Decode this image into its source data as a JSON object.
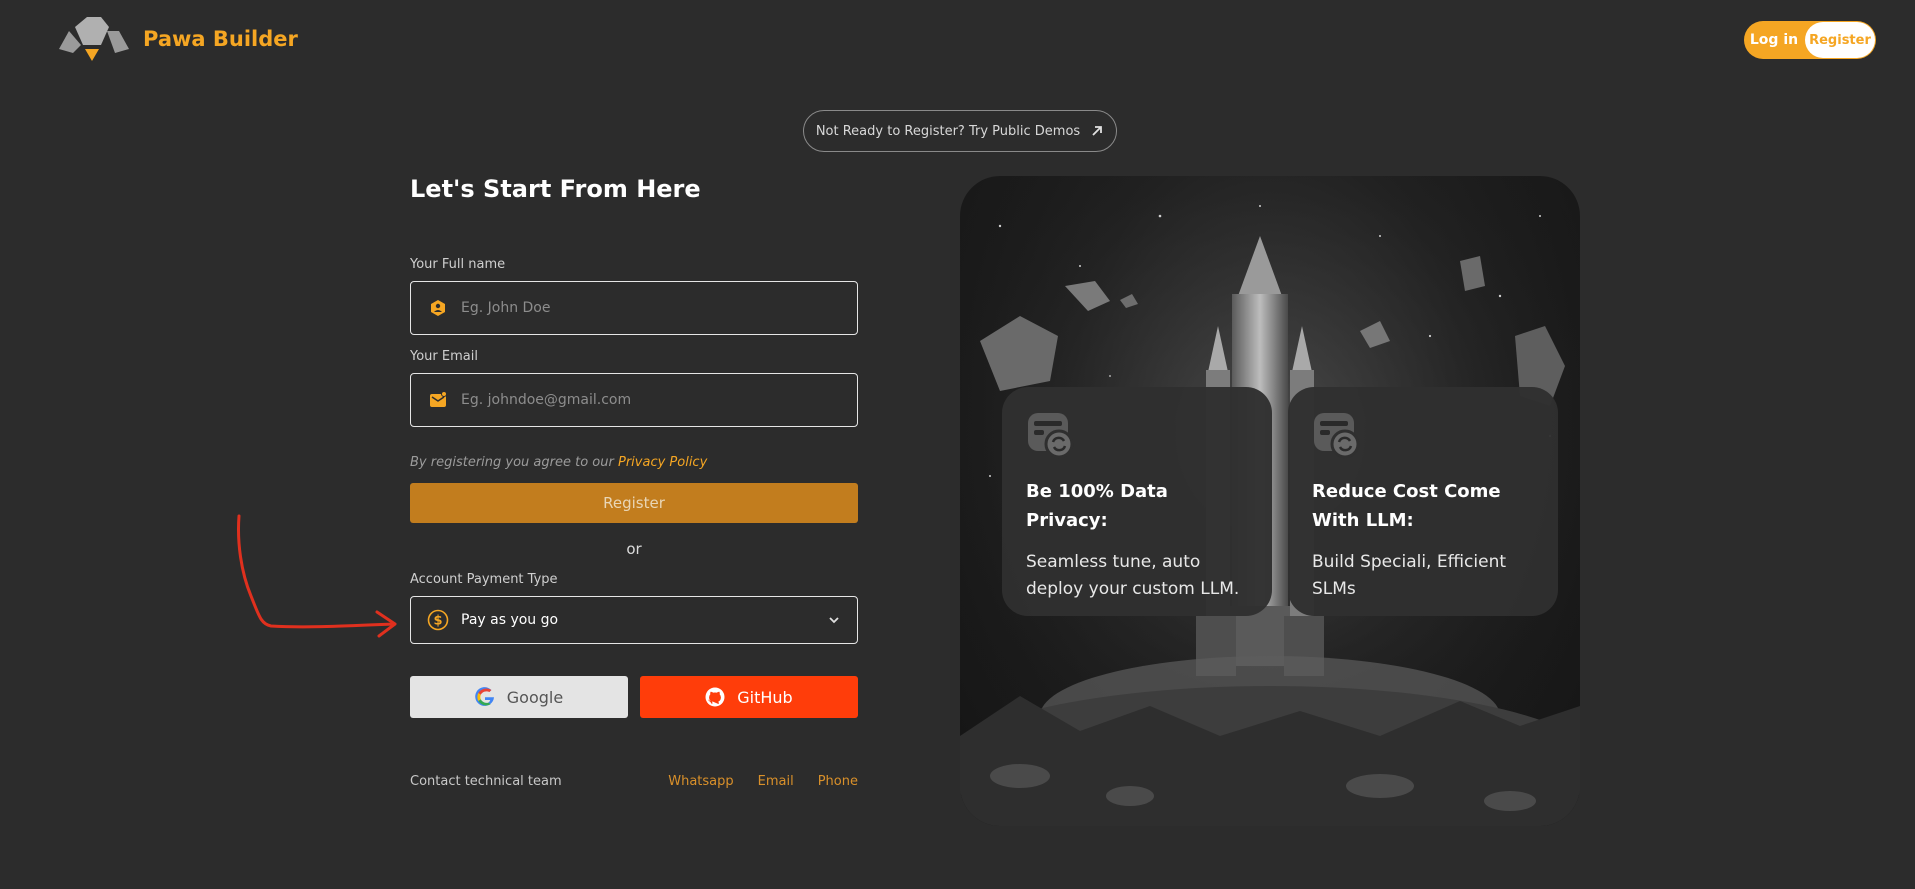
{
  "header": {
    "brand": "Pawa Builder",
    "login_label": "Log in",
    "register_label": "Register"
  },
  "demo_link": "Not Ready to Register? Try Public Demos",
  "form": {
    "title": "Let's Start From Here",
    "name_label": "Your Full name",
    "name_placeholder": "Eg. John Doe",
    "email_label": "Your Email",
    "email_placeholder": "Eg. johndoe@gmail.com",
    "agree_text": "By registering you agree to our",
    "privacy_link": "Privacy Policy",
    "register_button": "Register",
    "or_text": "or",
    "payment_label": "Account Payment Type",
    "payment_selected": "Pay as you go",
    "google_button": "Google",
    "github_button": "GitHub",
    "contact_text": "Contact technical team",
    "contact_links": [
      "Whatsapp",
      "Email",
      "Phone"
    ]
  },
  "features": [
    {
      "title": "Be 100% Data Privacy:",
      "desc": "Seamless tune, auto deploy your custom LLM."
    },
    {
      "title": "Reduce Cost Come With LLM:",
      "desc": "Build Speciali, Efficient SLMs"
    }
  ],
  "colors": {
    "accent": "#f5a623",
    "register_button": "#c27d1e",
    "github": "#ff3d0a",
    "background": "#2c2c2c",
    "annotation_arrow": "#e0301e"
  }
}
